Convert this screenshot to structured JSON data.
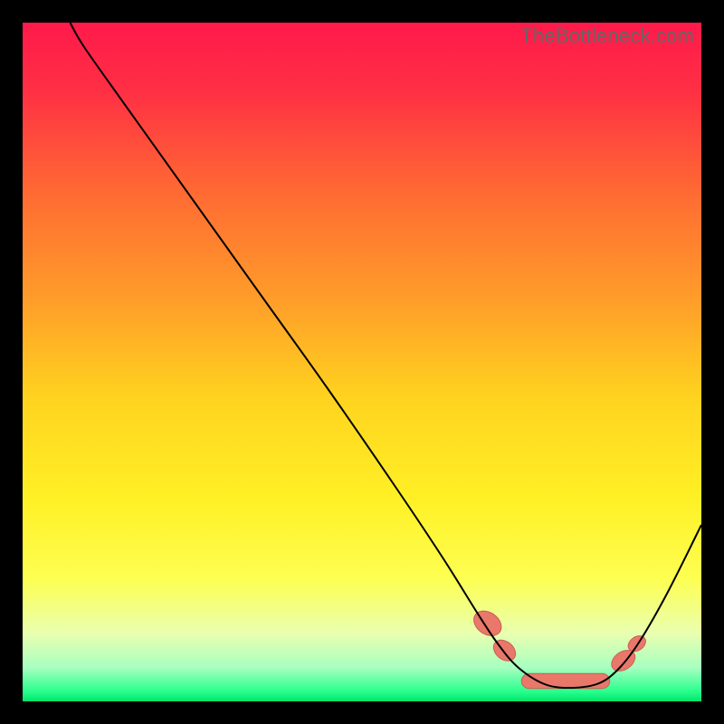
{
  "watermark": "TheBottleneck.com",
  "chart_data": {
    "type": "line",
    "title": "",
    "xlabel": "",
    "ylabel": "",
    "xlim": [
      0,
      100
    ],
    "ylim": [
      0,
      100
    ],
    "grid": false,
    "legend": false,
    "background": {
      "gradient_stops": [
        {
          "offset": 0.0,
          "color": "#ff1a4b"
        },
        {
          "offset": 0.1,
          "color": "#ff2f44"
        },
        {
          "offset": 0.25,
          "color": "#ff6a33"
        },
        {
          "offset": 0.4,
          "color": "#ff9a2a"
        },
        {
          "offset": 0.55,
          "color": "#ffd21f"
        },
        {
          "offset": 0.7,
          "color": "#fff025"
        },
        {
          "offset": 0.82,
          "color": "#fdff52"
        },
        {
          "offset": 0.9,
          "color": "#e9ffb0"
        },
        {
          "offset": 0.95,
          "color": "#a8ffc0"
        },
        {
          "offset": 0.985,
          "color": "#2aff8e"
        },
        {
          "offset": 1.0,
          "color": "#00e56a"
        }
      ]
    },
    "series": [
      {
        "name": "curve",
        "stroke": "#000000",
        "stroke_width": 2,
        "points": [
          {
            "x": 7.0,
            "y": 100.0
          },
          {
            "x": 9.0,
            "y": 96.5
          },
          {
            "x": 15.0,
            "y": 88.0
          },
          {
            "x": 25.0,
            "y": 74.0
          },
          {
            "x": 35.0,
            "y": 60.0
          },
          {
            "x": 45.0,
            "y": 46.0
          },
          {
            "x": 55.0,
            "y": 31.5
          },
          {
            "x": 62.0,
            "y": 21.0
          },
          {
            "x": 67.0,
            "y": 13.0
          },
          {
            "x": 70.0,
            "y": 8.5
          },
          {
            "x": 73.0,
            "y": 5.0
          },
          {
            "x": 77.0,
            "y": 2.5
          },
          {
            "x": 81.0,
            "y": 2.0
          },
          {
            "x": 85.0,
            "y": 2.7
          },
          {
            "x": 88.0,
            "y": 5.0
          },
          {
            "x": 91.0,
            "y": 9.0
          },
          {
            "x": 95.0,
            "y": 16.0
          },
          {
            "x": 100.0,
            "y": 26.0
          }
        ]
      }
    ],
    "markers": {
      "color": "#e9786a",
      "stroke": "#c95e52",
      "ellipses": [
        {
          "cx": 68.5,
          "cy": 11.5,
          "rx": 1.6,
          "ry": 2.2,
          "rot": -55
        },
        {
          "cx": 71.0,
          "cy": 7.5,
          "rx": 1.3,
          "ry": 1.8,
          "rot": -50
        },
        {
          "cx": 88.5,
          "cy": 6.0,
          "rx": 1.3,
          "ry": 1.9,
          "rot": 55
        },
        {
          "cx": 90.5,
          "cy": 8.5,
          "rx": 1.0,
          "ry": 1.4,
          "rot": 55
        }
      ],
      "band": {
        "x1": 73.5,
        "x2": 86.5,
        "y": 3.0,
        "half_width": 1.1
      }
    }
  }
}
